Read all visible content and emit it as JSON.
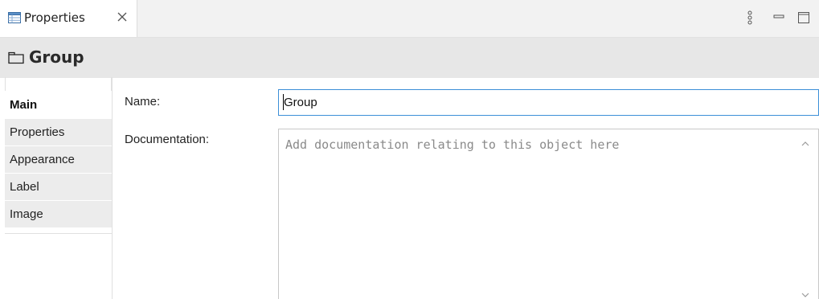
{
  "tab": {
    "label": "Properties",
    "icon": "properties-table-icon",
    "close_icon": "close-icon"
  },
  "toolbar": {
    "menu_icon": "view-menu-icon",
    "minimize_icon": "minimize-icon",
    "maximize_icon": "maximize-icon"
  },
  "header": {
    "title": "Group",
    "icon": "group-folder-icon"
  },
  "side_tabs": [
    {
      "label": "Main",
      "active": true
    },
    {
      "label": "Properties",
      "active": false
    },
    {
      "label": "Appearance",
      "active": false
    },
    {
      "label": "Label",
      "active": false
    },
    {
      "label": "Image",
      "active": false
    }
  ],
  "form": {
    "name_label": "Name:",
    "name_value": "Group",
    "documentation_label": "Documentation:",
    "documentation_placeholder": "Add documentation relating to this object here",
    "documentation_value": ""
  },
  "colors": {
    "focus_border": "#3c8fd8",
    "header_bg": "#e7e7e7",
    "tab_bg": "#ececec"
  }
}
